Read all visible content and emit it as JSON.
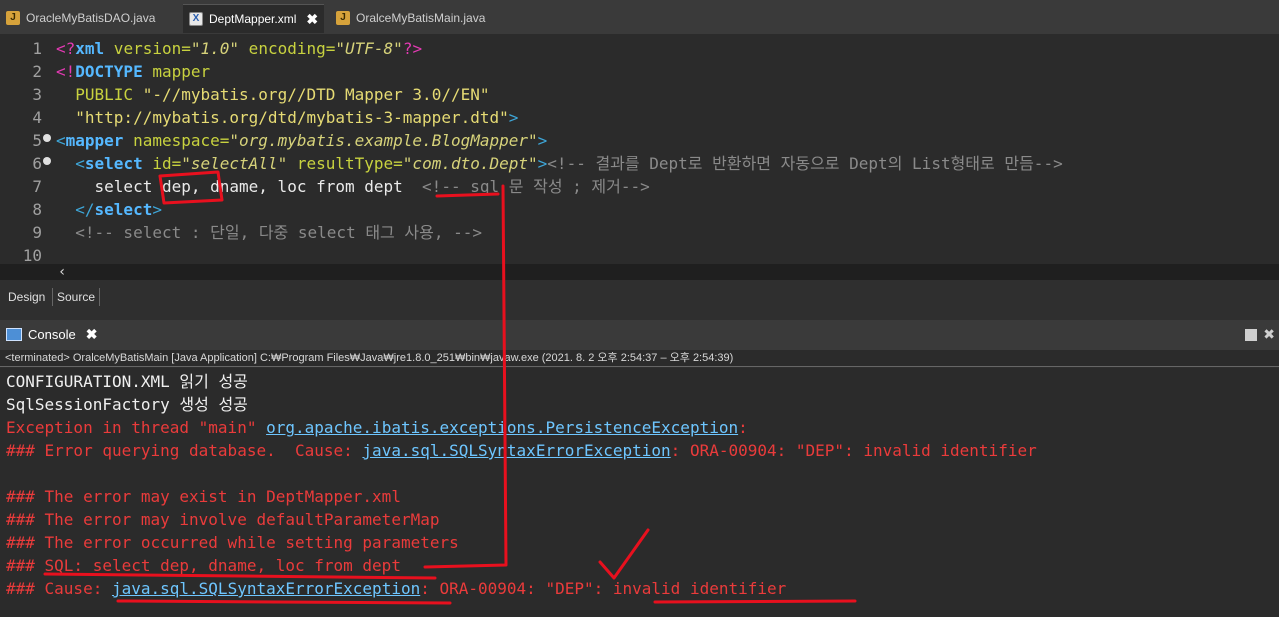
{
  "tabs": [
    {
      "label": "OracleMyBatisDAO.java",
      "icon": "java-file-icon"
    },
    {
      "label": "DeptMapper.xml",
      "icon": "xml-file-icon",
      "close": "✖"
    },
    {
      "label": "OralceMyBatisMain.java",
      "icon": "java-file-icon"
    }
  ],
  "editor": {
    "line_numbers": [
      "1",
      "2",
      "3",
      "4",
      "5",
      "6",
      "7",
      "8",
      "9",
      "10"
    ],
    "line1": {
      "a": "<?",
      "b": "xml",
      "c": " version=",
      "d": "\"1.0\"",
      "e": " encoding=",
      "f": "\"UTF-8\"",
      "g": "?>"
    },
    "line2": {
      "a": "<!",
      "b": "DOCTYPE",
      "c": " mapper"
    },
    "line3": {
      "a": "  PUBLIC ",
      "b": "\"-//mybatis.org//DTD Mapper 3.0//EN\""
    },
    "line4": {
      "a": "  ",
      "b": "\"http://mybatis.org/dtd/mybatis-3-mapper.dtd\"",
      "c": ">"
    },
    "line5": {
      "a": "<",
      "b": "mapper",
      "c": " namespace=",
      "d": "\"org.mybatis.example.BlogMapper\"",
      "e": ">"
    },
    "line6": {
      "a": "  <",
      "b": "select",
      "c": " id=",
      "d": "\"selectAll\"",
      "e": " resultType=",
      "f": "\"com.dto.Dept\"",
      "g": ">",
      "h": "<!-- 결과를 Dept로 반환하면 자동으로 Dept의 List형태로 만듬-->"
    },
    "line7": {
      "a": "    select dep, dname, loc from dept  ",
      "b": "<!-- sql 문 작성 ; 제거-->"
    },
    "line8": {
      "a": "  </",
      "b": "select",
      "c": ">"
    },
    "line9": {
      "a": "  <!-- select : 단일, 다중 select 태그 사용, -->"
    },
    "scroll_arrow": "‹"
  },
  "bottom_tabs": {
    "design": "Design",
    "source": "Source"
  },
  "console": {
    "tab_label": "Console",
    "close": "✖",
    "status": "<terminated> OralceMyBatisMain [Java Application] C:₩Program Files₩Java₩jre1.8.0_251₩bin₩javaw.exe  (2021. 8. 2 오후 2:54:37 – 오후 2:54:39)",
    "lines": {
      "l1": "CONFIGURATION.XML 읽기 성공",
      "l2": "SqlSessionFactory 생성 성공",
      "l3a": "Exception in thread \"main\" ",
      "l3b": "org.apache.ibatis.exceptions.PersistenceException",
      "l3c": ":",
      "l4a": "### Error querying database.  Cause: ",
      "l4b": "java.sql.SQLSyntaxErrorException",
      "l4c": ": ORA-00904: \"DEP\": invalid identifier",
      "l6": "### The error may exist in DeptMapper.xml",
      "l7": "### The error may involve defaultParameterMap",
      "l8": "### The error occurred while setting parameters",
      "l9": "### SQL: select dep, dname, loc from dept",
      "l10a": "### Cause: ",
      "l10b": "java.sql.SQLSyntaxErrorException",
      "l10c": ": ORA-00904: \"DEP\": invalid identifier"
    }
  },
  "colors": {
    "annotation": "#e8101e",
    "error_text": "#ea3b3b",
    "link": "#6ec6ff"
  }
}
